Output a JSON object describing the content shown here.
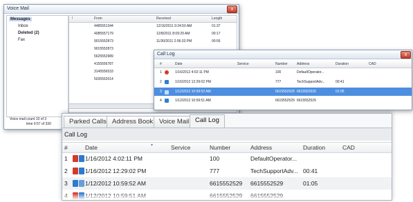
{
  "voicemail": {
    "title": "Voice Mail",
    "close": "x",
    "tree": [
      "Messages",
      "Inbox",
      "Deleted (2)",
      "Fax"
    ],
    "columns": [
      "!",
      "From",
      "Received",
      "Length"
    ],
    "rows": [
      {
        "from": "4485551344",
        "received": "12/16/2011 9:24:50 AM",
        "length": "01:37"
      },
      {
        "from": "4085557179",
        "received": "12/8/2011 8:09:29 AM",
        "length": "00:17"
      },
      {
        "from": "9015552873",
        "received": "11/30/2011 2:06:33 PM",
        "length": "00:55"
      },
      {
        "from": "9015552873",
        "received": "",
        "length": ""
      },
      {
        "from": "5625552989",
        "received": "",
        "length": ""
      },
      {
        "from": "4155556787",
        "received": "",
        "length": ""
      },
      {
        "from": "3145556533",
        "received": "",
        "length": ""
      },
      {
        "from": "5035552014",
        "received": "",
        "length": ""
      }
    ],
    "status_line1": "Voice mail count 10 of 3",
    "status_line2": "time 6:57 of 330"
  },
  "calllog_small": {
    "title": "Call Log",
    "close": "x",
    "columns": [
      "#",
      "Date",
      "Service",
      "Number",
      "Address",
      "Duration",
      "CAD"
    ],
    "rows": [
      {
        "n": "1",
        "date": "1/16/2012 4:02:11 PM",
        "number": "100",
        "address": "DefaultOperator...",
        "duration": ""
      },
      {
        "n": "2",
        "date": "1/16/2012 12:29:02 PM",
        "number": "777",
        "address": "TechSupportAdv...",
        "duration": "00:41"
      },
      {
        "n": "3",
        "date": "1/12/2012 10:59:52 AM",
        "number": "6615552529",
        "address": "6615552529",
        "duration": "01:05"
      },
      {
        "n": "4",
        "date": "1/12/2012 10:59:51 AM",
        "number": "6615552529",
        "address": "6615552529",
        "duration": ""
      }
    ]
  },
  "front": {
    "tabs": [
      "Parked Calls",
      "Address Book",
      "Voice Mail",
      "Call Log"
    ],
    "active_tab": "Call Log",
    "section_title": "Call Log",
    "columns": [
      "#",
      "Date",
      "Service",
      "Number",
      "Address",
      "Duration",
      "CAD"
    ],
    "rows": [
      {
        "n": "1",
        "date": "1/16/2012 4:02:11 PM",
        "number": "100",
        "address": "DefaultOperator...",
        "duration": ""
      },
      {
        "n": "2",
        "date": "1/16/2012 12:29:02 PM",
        "number": "777",
        "address": "TechSupportAdv...",
        "duration": "00:41"
      },
      {
        "n": "3",
        "date": "1/12/2012 10:59:52 AM",
        "number": "6615552529",
        "address": "6615552529",
        "duration": "01:05"
      },
      {
        "n": "4",
        "date": "1/12/2012 10:59:51 AM",
        "number": "6615552529",
        "address": "6615552529",
        "duration": ""
      }
    ]
  }
}
